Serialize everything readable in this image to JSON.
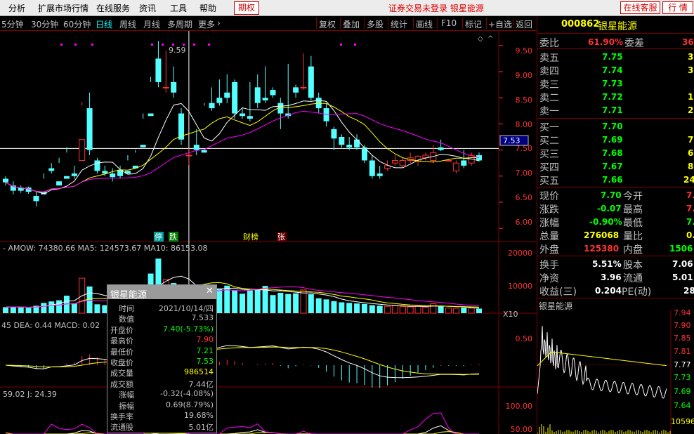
{
  "menu": [
    "分析",
    "扩展市场行情",
    "在线服务",
    "资讯",
    "工具",
    "帮助"
  ],
  "menu_qiquan": "期权",
  "notice": "证券交易未登录  银星能源",
  "top_buttons": [
    "在线客服",
    "行 情"
  ],
  "periods": [
    "5分钟",
    "30分钟",
    "60分钟",
    "日线",
    "周线",
    "月线",
    "多周期",
    "更多"
  ],
  "active_period": "日线",
  "tools": [
    "复权",
    "叠加",
    "多股",
    "统计",
    "画线",
    "F10",
    "标记",
    "+自选",
    "返回"
  ],
  "colors": {
    "up": "#ff3232",
    "down": "#54ffff",
    "ma5": "#ffffff",
    "ma10": "#ffff00",
    "ma20": "#ff00ff",
    "grid": "#800000"
  },
  "chart": {
    "price_axis": [
      "9.50",
      "9.00",
      "8.50",
      "8.00",
      "7.50",
      "7.00",
      "6.50",
      "6.00"
    ],
    "price_min": 5.8,
    "price_max": 9.7,
    "crosshair_price": "7.53",
    "high_marker": "9.59",
    "markers": [
      "停",
      "跌",
      "财榜",
      "张"
    ],
    "candles": [
      [
        6.95,
        7.0,
        6.88,
        6.82
      ],
      [
        6.82,
        6.9,
        6.72,
        6.65
      ],
      [
        6.78,
        6.82,
        6.72,
        6.68
      ],
      [
        6.78,
        6.8,
        6.7,
        6.66
      ],
      [
        6.62,
        6.72,
        6.52,
        6.42
      ],
      [
        6.7,
        7.05,
        6.65,
        6.95
      ],
      [
        7.15,
        7.25,
        7.1,
        7.05
      ],
      [
        6.9,
        7.35,
        6.82,
        7.25
      ],
      [
        7.0,
        7.55,
        6.95,
        7.45
      ],
      [
        7.05,
        7.2,
        7.0,
        6.95
      ],
      [
        7.3,
        8.42,
        7.7,
        8.35
      ],
      [
        8.3,
        8.6,
        7.5,
        7.4
      ],
      [
        7.3,
        7.35,
        7.1,
        7.05
      ],
      [
        7.1,
        7.2,
        7.05,
        7.0
      ],
      [
        7.05,
        7.15,
        6.98,
        6.9
      ],
      [
        7.12,
        7.2,
        7.0,
        6.95
      ],
      [
        7.1,
        7.4,
        7.05,
        7.3
      ],
      [
        7.2,
        7.5,
        7.15,
        7.45
      ],
      [
        7.6,
        8.2,
        7.55,
        8.1
      ],
      [
        8.2,
        8.9,
        8.15,
        8.8
      ],
      [
        9.25,
        9.59,
        8.8,
        8.7
      ],
      [
        8.7,
        9.4,
        8.7,
        8.6
      ],
      [
        8.8,
        9.1,
        8.6,
        8.5
      ],
      [
        8.2,
        8.3,
        7.7,
        7.6
      ],
      [
        7.4,
        7.53,
        7.4,
        7.21
      ],
      [
        7.6,
        7.9,
        7.5,
        7.4
      ],
      [
        7.5,
        8.4,
        7.45,
        8.35
      ],
      [
        8.4,
        8.7,
        8.3,
        8.25
      ],
      [
        8.5,
        8.85,
        8.4,
        8.35
      ],
      [
        8.6,
        8.95,
        8.5,
        8.4
      ],
      [
        8.8,
        8.85,
        8.2,
        8.1
      ],
      [
        8.2,
        8.3,
        8.15,
        8.1
      ],
      [
        8.15,
        8.8,
        8.1,
        8.05
      ],
      [
        8.7,
        8.95,
        8.4,
        8.3
      ],
      [
        8.5,
        9.1,
        8.45,
        8.4
      ],
      [
        8.65,
        8.7,
        8.55,
        8.5
      ],
      [
        8.4,
        8.5,
        8.2,
        7.9
      ],
      [
        8.2,
        9.15,
        8.15,
        8.1
      ],
      [
        8.7,
        8.75,
        8.6,
        8.5
      ],
      [
        8.7,
        9.35,
        8.7,
        8.65
      ],
      [
        9.1,
        9.3,
        8.5,
        8.45
      ],
      [
        8.5,
        8.6,
        8.3,
        8.2
      ],
      [
        8.3,
        8.4,
        8.05,
        7.95
      ],
      [
        7.9,
        7.95,
        7.72,
        7.5
      ],
      [
        7.75,
        7.8,
        7.6,
        7.55
      ],
      [
        7.6,
        7.75,
        7.55,
        7.5
      ],
      [
        7.7,
        7.8,
        7.55,
        7.5
      ],
      [
        7.55,
        7.6,
        7.3,
        7.25
      ],
      [
        7.3,
        7.4,
        7.0,
        6.95
      ],
      [
        7.05,
        7.2,
        7.0,
        6.95
      ],
      [
        7.15,
        7.3,
        7.2,
        7.1
      ],
      [
        7.25,
        7.4,
        7.3,
        7.2
      ],
      [
        7.2,
        7.35,
        7.3,
        7.15
      ],
      [
        7.3,
        7.45,
        7.35,
        7.25
      ],
      [
        7.28,
        7.4,
        7.38,
        7.2
      ],
      [
        7.35,
        7.45,
        7.4,
        7.3
      ],
      [
        7.3,
        7.6,
        7.45,
        7.25
      ],
      [
        7.55,
        7.7,
        7.5,
        7.48
      ],
      [
        7.3,
        7.32,
        7.3,
        7.28
      ],
      [
        7.1,
        7.3,
        7.25,
        7.05
      ],
      [
        7.3,
        7.5,
        7.2,
        7.15
      ],
      [
        7.25,
        7.45,
        7.4,
        7.2
      ],
      [
        7.4,
        7.45,
        7.3,
        7.28
      ]
    ],
    "vol_title": "AMOW: 74380.66 MA5: 124573.67 MA10: 86153.08",
    "vol_axis": [
      "20000",
      "10000"
    ],
    "vol_unit": "X10",
    "vol_max": 22000,
    "volumes": [
      2100,
      2300,
      2000,
      1900,
      2600,
      3600,
      4100,
      4500,
      6100,
      3500,
      12200,
      9300,
      3100,
      2800,
      2400,
      2600,
      3400,
      3800,
      7200,
      13800,
      19000,
      11800,
      10500,
      9300,
      8900,
      7300,
      9100,
      8600,
      8400,
      9600,
      8100,
      6800,
      7900,
      8300,
      9500,
      6300,
      7100,
      6700,
      6900,
      8100,
      6600,
      5200,
      4800,
      4200,
      3800,
      3600,
      3400,
      3200,
      2800,
      2600,
      2400,
      2600,
      2300,
      2200,
      2500,
      2100,
      3300,
      2400,
      1800,
      1700,
      2000,
      1800,
      1600
    ],
    "macd_title": "45 DEA: 0.44  MACD: 0.02",
    "macd_axis": [
      "0.50"
    ],
    "kdj_title": "59.02  J: 24.39",
    "kdj_axis": [
      "100.00",
      "50.00"
    ]
  },
  "quote": {
    "code": "000862",
    "name": "银星能源",
    "weibi_label": "委比",
    "weibi_value": "61.90%",
    "weicha_label": "委差",
    "weicha_value": "36",
    "sell": [
      {
        "label": "卖五",
        "price": "7.75",
        "vol": "3"
      },
      {
        "label": "卖四",
        "price": "7.74",
        "vol": "3"
      },
      {
        "label": "卖三",
        "price": "7.73",
        "vol": ""
      },
      {
        "label": "卖二",
        "price": "7.72",
        "vol": "1"
      },
      {
        "label": "卖一",
        "price": "7.71",
        "vol": "2"
      }
    ],
    "buy": [
      {
        "label": "买一",
        "price": "7.70",
        "vol": ""
      },
      {
        "label": "买二",
        "price": "7.69",
        "vol": "7"
      },
      {
        "label": "买三",
        "price": "7.68",
        "vol": "6"
      },
      {
        "label": "买四",
        "price": "7.67",
        "vol": "8"
      },
      {
        "label": "买五",
        "price": "7.66",
        "vol": "24"
      }
    ],
    "stats": [
      {
        "l1": "现价",
        "v1": "7.70",
        "c1": "#00ff00",
        "l2": "今开",
        "v2": "7."
      },
      {
        "l1": "涨跌",
        "v1": "-0.07",
        "c1": "#00ff00",
        "l2": "最高",
        "v2": "7."
      },
      {
        "l1": "涨幅",
        "v1": "-0.90%",
        "c1": "#00ff00",
        "l2": "最低",
        "v2": "7."
      },
      {
        "l1": "总量",
        "v1": "276068",
        "c1": "#ffff00",
        "l2": "量比",
        "v2": "0."
      },
      {
        "l1": "外盘",
        "v1": "125380",
        "c1": "#ff3232",
        "l2": "内盘",
        "v2": "1506"
      }
    ],
    "fin": [
      {
        "l1": "换手",
        "v1": "5.51%",
        "l2": "股本",
        "v2": "7.06"
      },
      {
        "l1": "净资",
        "v1": "3.96",
        "l2": "流通",
        "v2": "5.01"
      },
      {
        "l1": "收益(三)",
        "v1": "0.204",
        "l2": "PE(动)",
        "v2": "28"
      }
    ],
    "mini_title": "银星能源",
    "mini_axis": [
      "7.94",
      "7.90",
      "7.85",
      "7.81",
      "7.77",
      "7.73",
      "7.69",
      "7.64",
      "10596"
    ]
  },
  "tooltip": {
    "title": "银星能源",
    "rows": [
      {
        "label": "时间",
        "value": "2021/10/14/四",
        "color": "#c0c0c0"
      },
      {
        "label": "数值",
        "value": "7.533",
        "color": "#c0c0c0"
      },
      {
        "label": "开盘价",
        "value": "7.40(-5.73%)",
        "color": "#00ff00"
      },
      {
        "label": "最高价",
        "value": "7.90",
        "color": "#ff3232"
      },
      {
        "label": "最低价",
        "value": "7.21",
        "color": "#00ff00"
      },
      {
        "label": "收盘价",
        "value": "7.53",
        "color": "#00ff00"
      },
      {
        "label": "成交量",
        "value": "986514",
        "color": "#ffff00"
      },
      {
        "label": "成交额",
        "value": "7.44亿",
        "color": "#c0c0c0"
      },
      {
        "label": "涨幅",
        "value": "-0.32(-4.08%)",
        "color": "#c0c0c0"
      },
      {
        "label": "振幅",
        "value": "0.69(8.79%)",
        "color": "#c0c0c0"
      },
      {
        "label": "换手率",
        "value": "19.68%",
        "color": "#c0c0c0"
      },
      {
        "label": "流通股",
        "value": "5.01亿",
        "color": "#c0c0c0"
      }
    ]
  }
}
